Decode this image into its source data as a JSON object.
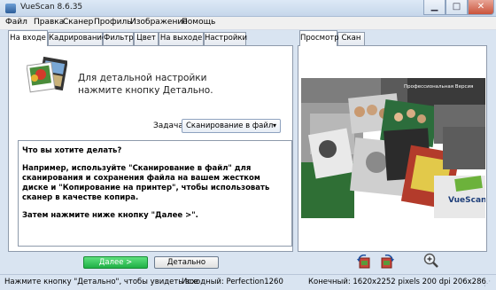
{
  "window": {
    "title": "VueScan 8.6.35"
  },
  "menu": [
    "Файл",
    "Правка",
    "Сканер",
    "Профиль",
    "Изображение",
    "Помощь"
  ],
  "left_tabs": [
    "На входе",
    "Кадрирование",
    "Фильтр",
    "Цвет",
    "На выходе",
    "Настройки"
  ],
  "right_tabs": [
    "Просмотр",
    "Скан"
  ],
  "hint": {
    "line1": "Для детальной настройки",
    "line2": "нажмите кнопку Детально."
  },
  "task": {
    "label": "Задача:",
    "value": "Сканирование в файл"
  },
  "info": {
    "p1": "Что вы хотите делать?",
    "p2": "Например, используйте \"Сканирование в файл\" для сканирования и сохранения файла на вашем жестком диске и \"Копирование на принтер\", чтобы использовать сканер в качестве копира.",
    "p3": "Затем нажмите ниже кнопку \"Далее >\"."
  },
  "preview": {
    "pro_label": "Профессиональная Версия",
    "brand": "VueScan"
  },
  "buttons": {
    "next": "Далее >",
    "detail": "Детально"
  },
  "status": {
    "left": "Нажмите кнопку \"Детально\", чтобы увидеть все",
    "source": "Исходный: Perfection1260",
    "output": "Конечный: 1620x2252 pixels 200 dpi 206x286"
  }
}
